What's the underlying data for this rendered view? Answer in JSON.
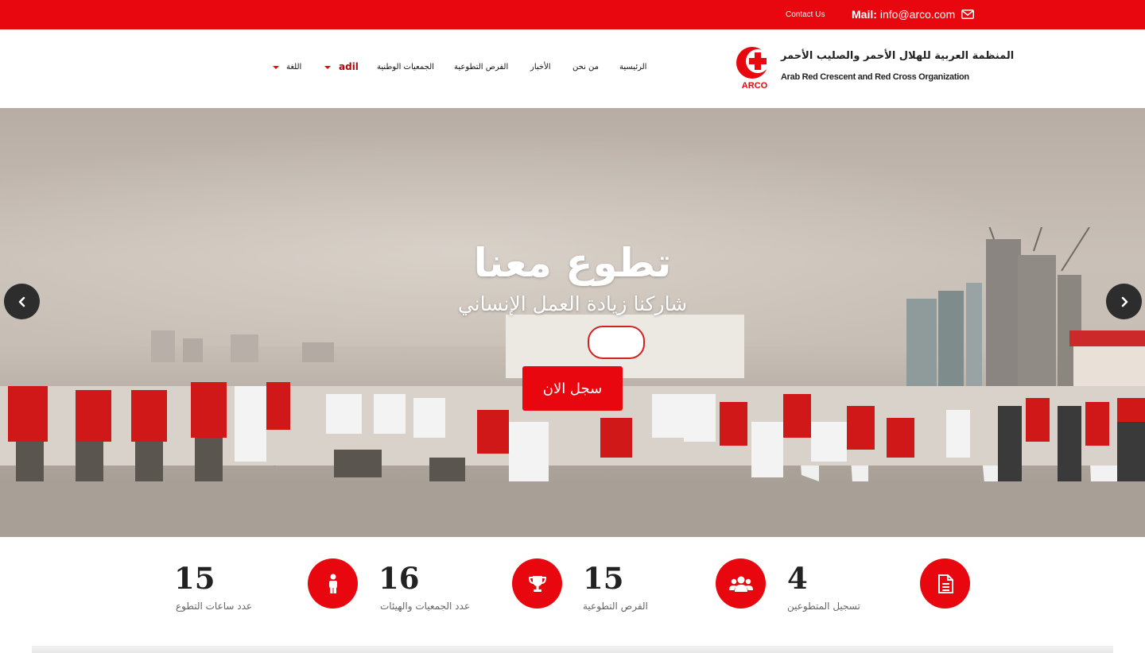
{
  "topbar": {
    "contact_label": "Contact Us",
    "mail_label": "Mail:",
    "mail_value": "info@arco.com",
    "mail_icon": "envelope-icon"
  },
  "logo": {
    "arabic_name": "المنظمة العربية للهلال الأحمر والصليب الأحمر",
    "english_name": "Arab Red Crescent and Red Cross Organization",
    "emblem_text": "ARCO"
  },
  "nav": {
    "items": [
      {
        "label": "الرئيسية"
      },
      {
        "label": "من نحن"
      },
      {
        "label": "الأخبار"
      },
      {
        "label": "الفرص التطوعية"
      },
      {
        "label": "الجمعيات الوطنية"
      }
    ],
    "user": "adil",
    "language": "اللغة"
  },
  "hero": {
    "title": "تطوع معنا",
    "subtitle": "شاركنا زيادة العمل الإنساني",
    "cta": "سجل الان"
  },
  "stats": [
    {
      "value": "15",
      "label": "عدد ساعات التطوع",
      "icon": "document-icon"
    },
    {
      "value": "16",
      "label": "عدد الجمعيات والهيئات",
      "icon": "person-icon"
    },
    {
      "value": "15",
      "label": "الفرص التطوعية",
      "icon": "trophy-icon"
    },
    {
      "value": "4",
      "label": "تسجيل المتطوعين",
      "icon": "users-icon"
    }
  ],
  "colors": {
    "brand_red": "#e8070e",
    "dark_red": "#b3080c"
  }
}
